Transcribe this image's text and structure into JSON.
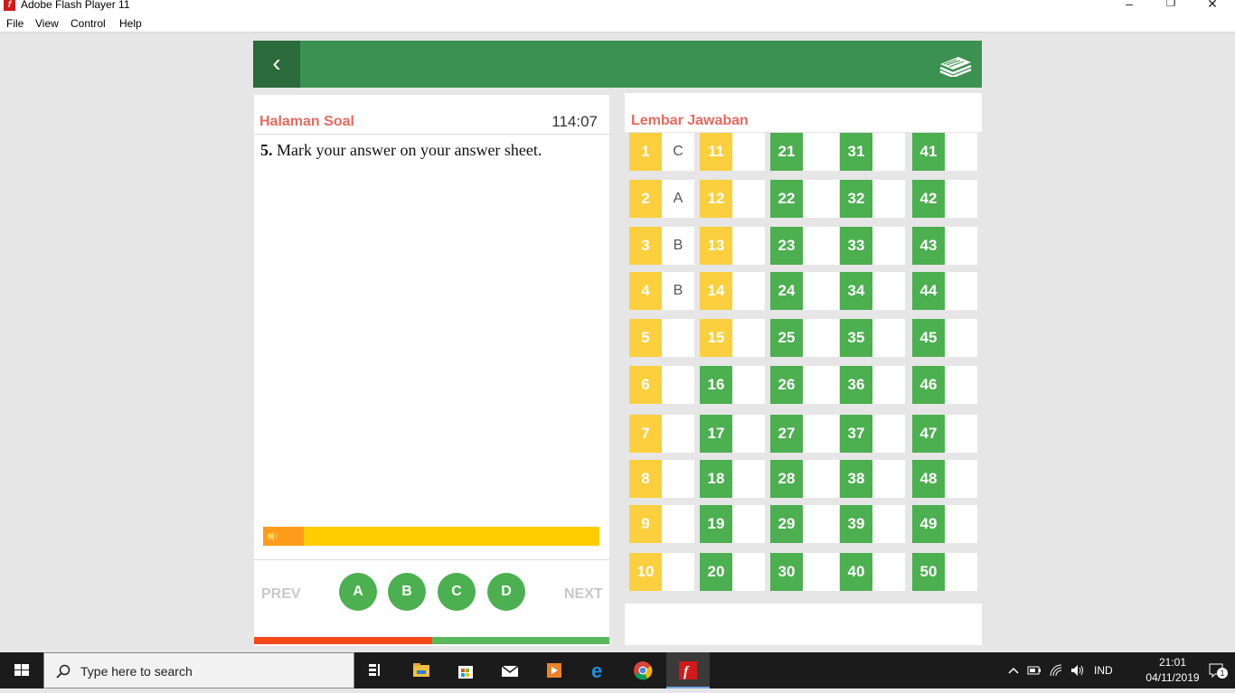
{
  "window": {
    "title": "Adobe Flash Player 11",
    "minimize": "–",
    "maximize": "❐",
    "close": "✕"
  },
  "menu": [
    "File",
    "View",
    "Control",
    "Help"
  ],
  "topbar": {
    "back_glyph": "‹"
  },
  "question_panel": {
    "title": "Halaman Soal",
    "timer": "114:07",
    "question_number": "5.",
    "question_text": " Mark your answer on your answer sheet.",
    "audio_progress": 0.12,
    "prev_label": "PREV",
    "next_label": "NEXT",
    "options": [
      "A",
      "B",
      "C",
      "D"
    ],
    "progress_bar": {
      "left_color": "#f44a1a",
      "right_color": "#5cb85c"
    }
  },
  "answer_sheet": {
    "title": "Lembar Jawaban",
    "answers": {
      "1": "C",
      "2": "A",
      "3": "B",
      "4": "B"
    },
    "yellow_numbers": [
      1,
      2,
      3,
      4,
      5,
      6,
      7,
      8,
      9,
      10,
      11,
      12,
      13,
      14,
      15
    ],
    "colors": {
      "yellow": "#fbcf3d",
      "green": "#4caf50"
    }
  },
  "taskbar": {
    "search_placeholder": "Type here to search",
    "apps": [
      "task-view-icon",
      "file-explorer-icon",
      "store-icon",
      "mail-icon",
      "media-player-icon",
      "edge-icon",
      "chrome-icon",
      "flash-player-icon"
    ],
    "language": "IND",
    "time": "21:01",
    "date": "04/11/2019",
    "notification_count": "1"
  }
}
